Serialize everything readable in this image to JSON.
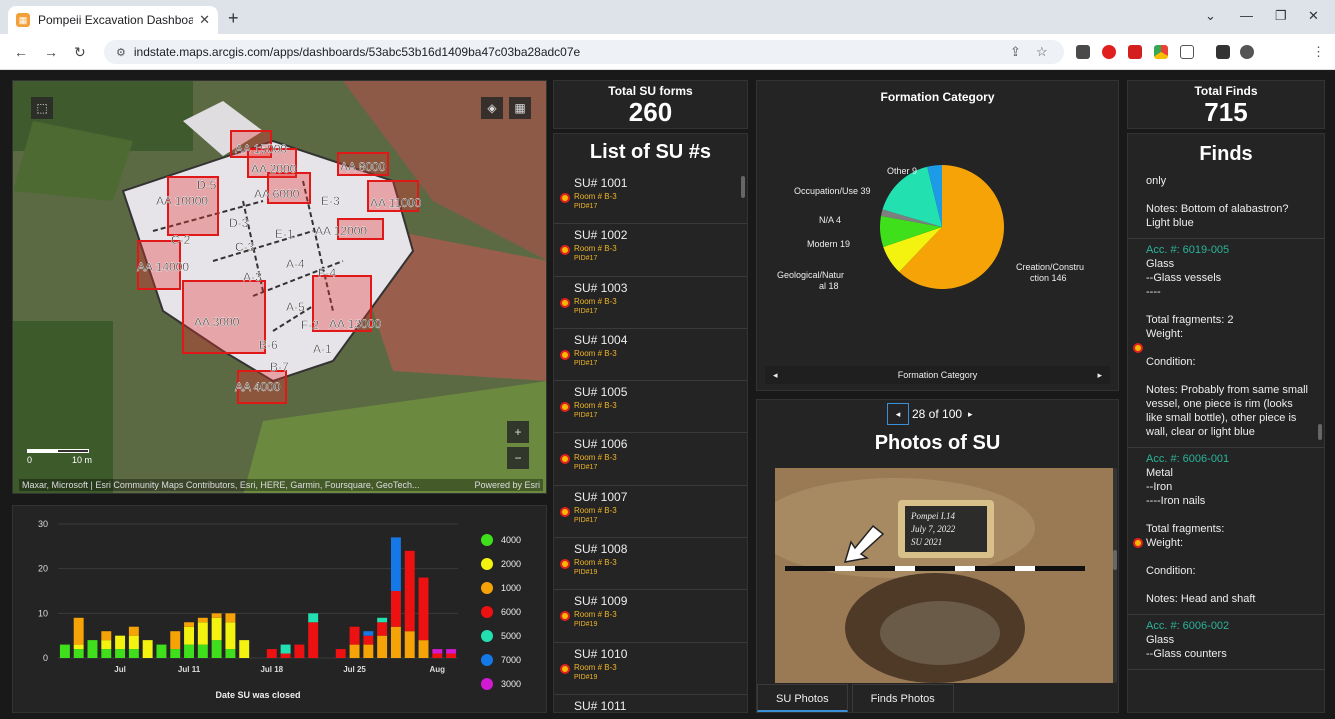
{
  "browser": {
    "tab_title": "Pompeii Excavation Dashboard",
    "url": "indstate.maps.arcgis.com/apps/dashboards/53abc53b16d1409ba47c03ba28adc07e"
  },
  "map": {
    "attribution": "Maxar, Microsoft | Esri Community Maps Contributors, Esri, HERE, Garmin, Foursquare, GeoTech...",
    "powered_by": "Powered by Esri",
    "scale_start": "0",
    "scale_end": "10 m",
    "zoom_in": "+",
    "zoom_out": "−",
    "area_labels": [
      "AA 15000",
      "AA 2000",
      "AA 8000",
      "D-5",
      "AA 6000",
      "E-3",
      "AA 11000",
      "AA 10000",
      "D-3",
      "E-1",
      "AA 12000",
      "C-2",
      "C-3",
      "A-4",
      "AA 14000",
      "A-3",
      "F-4",
      "AA 3000",
      "A-5",
      "F-2",
      "AA 13000",
      "B-6",
      "A-1",
      "B-7",
      "AA 4000"
    ]
  },
  "bar_chart": {
    "xlabel": "Date SU was closed",
    "legend": [
      {
        "name": "4000",
        "color": "#3fe01b"
      },
      {
        "name": "2000",
        "color": "#f3f30f"
      },
      {
        "name": "1000",
        "color": "#f5a306"
      },
      {
        "name": "6000",
        "color": "#ee1111"
      },
      {
        "name": "5000",
        "color": "#23e0b0"
      },
      {
        "name": "7000",
        "color": "#1479e6"
      },
      {
        "name": "3000",
        "color": "#d21ad2"
      }
    ]
  },
  "chart_data": [
    {
      "type": "bar",
      "stacked": true,
      "xlabel": "Date SU was closed",
      "ylim": [
        0,
        30
      ],
      "yticks": [
        0,
        10,
        20,
        30
      ],
      "x_tick_labels": [
        "Jul",
        "Jul 11",
        "Jul 18",
        "Jul 25",
        "Aug"
      ],
      "categories": [
        "b1",
        "b2",
        "b3",
        "b4",
        "b5",
        "b6",
        "b7",
        "b8",
        "b9",
        "b10",
        "b11",
        "b12",
        "b13",
        "b14",
        "b15",
        "b16",
        "b17",
        "b18",
        "b19",
        "b20",
        "b21",
        "b22",
        "b23",
        "b24",
        "b25",
        "b26",
        "b27",
        "b28",
        "b29"
      ],
      "series": [
        {
          "name": "4000",
          "values": [
            3,
            2,
            4,
            2,
            2,
            2,
            0,
            3,
            2,
            3,
            3,
            4,
            2,
            0,
            0,
            0,
            0,
            0,
            0,
            0,
            0,
            0,
            0,
            0,
            0,
            0,
            0,
            0,
            0
          ]
        },
        {
          "name": "2000",
          "values": [
            0,
            1,
            0,
            2,
            3,
            3,
            4,
            0,
            0,
            4,
            5,
            5,
            6,
            4,
            0,
            0,
            0,
            0,
            0,
            0,
            0,
            0,
            0,
            0,
            0,
            0,
            0,
            0,
            0
          ]
        },
        {
          "name": "1000",
          "values": [
            0,
            6,
            0,
            2,
            0,
            2,
            0,
            0,
            4,
            1,
            1,
            1,
            2,
            0,
            0,
            0,
            0,
            0,
            0,
            0,
            0,
            3,
            3,
            5,
            7,
            6,
            4,
            0,
            0
          ]
        },
        {
          "name": "6000",
          "values": [
            0,
            0,
            0,
            0,
            0,
            0,
            0,
            0,
            0,
            0,
            0,
            0,
            0,
            0,
            0,
            2,
            1,
            3,
            8,
            0,
            2,
            4,
            2,
            3,
            8,
            18,
            14,
            1,
            1
          ]
        },
        {
          "name": "5000",
          "values": [
            0,
            0,
            0,
            0,
            0,
            0,
            0,
            0,
            0,
            0,
            0,
            0,
            0,
            0,
            0,
            0,
            2,
            0,
            2,
            0,
            0,
            0,
            0,
            1,
            0,
            0,
            0,
            0,
            0
          ]
        },
        {
          "name": "7000",
          "values": [
            0,
            0,
            0,
            0,
            0,
            0,
            0,
            0,
            0,
            0,
            0,
            0,
            0,
            0,
            0,
            0,
            0,
            0,
            0,
            0,
            0,
            0,
            1,
            0,
            12,
            0,
            0,
            0,
            0
          ]
        },
        {
          "name": "3000",
          "values": [
            0,
            0,
            0,
            0,
            0,
            0,
            0,
            0,
            0,
            0,
            0,
            0,
            0,
            0,
            0,
            0,
            0,
            0,
            0,
            0,
            0,
            0,
            0,
            0,
            0,
            0,
            0,
            1,
            1
          ]
        }
      ]
    },
    {
      "type": "pie",
      "title": "Formation Category",
      "slices": [
        {
          "label": "Creation/Construction 146",
          "value": 146,
          "color": "#f5a306"
        },
        {
          "label": "Geological/Natural 18",
          "value": 18,
          "color": "#f3f30f"
        },
        {
          "label": "Modern 19",
          "value": 19,
          "color": "#3fe01b"
        },
        {
          "label": "N/A 4",
          "value": 4,
          "color": "#7f7f7f"
        },
        {
          "label": "Occupation/Use 39",
          "value": 39,
          "color": "#23e0b0"
        },
        {
          "label": "Other 9",
          "value": 9,
          "color": "#1e9be6"
        }
      ]
    }
  ],
  "total_su": {
    "label": "Total SU forms",
    "value": "260"
  },
  "su_list": {
    "title": "List of SU #s",
    "items": [
      {
        "su": "SU# 1001",
        "room": "Room # B-3",
        "pid": "PID#17"
      },
      {
        "su": "SU# 1002",
        "room": "Room # B-3",
        "pid": "PID#17"
      },
      {
        "su": "SU# 1003",
        "room": "Room # B-3",
        "pid": "PID#17"
      },
      {
        "su": "SU# 1004",
        "room": "Room # B-3",
        "pid": "PID#17"
      },
      {
        "su": "SU# 1005",
        "room": "Room # B-3",
        "pid": "PID#17"
      },
      {
        "su": "SU# 1006",
        "room": "Room # B-3",
        "pid": "PID#17"
      },
      {
        "su": "SU# 1007",
        "room": "Room # B-3",
        "pid": "PID#17"
      },
      {
        "su": "SU# 1008",
        "room": "Room # B-3",
        "pid": "PID#19"
      },
      {
        "su": "SU# 1009",
        "room": "Room # B-3",
        "pid": "PID#19"
      },
      {
        "su": "SU# 1010",
        "room": "Room # B-3",
        "pid": "PID#19"
      },
      {
        "su": "SU# 1011",
        "room": "",
        "pid": ""
      }
    ]
  },
  "pie": {
    "title": "Formation Category",
    "nav_label": "Formation Category",
    "labels": {
      "other": "Other 9",
      "occupation": "Occupation/Use 39",
      "na": "N/A 4",
      "modern": "Modern 19",
      "geological_1": "Geological/Natur",
      "geological_2": "al 18",
      "creation_1": "Creation/Constru",
      "creation_2": "ction 146"
    }
  },
  "photos": {
    "pager": "28 of 100",
    "title": "Photos of SU",
    "tabs": [
      "SU Photos",
      "Finds Photos"
    ],
    "slate_text": [
      "Pompei I.14",
      "July 7, 2022",
      "SU 2021"
    ]
  },
  "total_finds": {
    "label": "Total Finds",
    "value": "715"
  },
  "finds": {
    "title": "Finds",
    "items": [
      {
        "lines": [
          "only",
          "",
          "Notes: Bottom of alabastron? Light blue"
        ]
      },
      {
        "acc": "Acc. #: 6019-005",
        "lines": [
          "Glass",
          "--Glass vessels",
          "----",
          "",
          "Total fragments: 2",
          "Weight:",
          "",
          "Condition:",
          "",
          "Notes: Probably from same small vessel, one piece is rim (looks like small bottle), other piece is wall, clear or light blue"
        ]
      },
      {
        "acc": "Acc. #: 6006-001",
        "lines": [
          "Metal",
          "--Iron",
          "----Iron nails",
          "",
          "Total fragments:",
          "Weight:",
          "",
          "Condition:",
          "",
          "Notes: Head and shaft"
        ]
      },
      {
        "acc": "Acc. #: 6006-002",
        "lines": [
          "Glass",
          "--Glass counters"
        ]
      }
    ]
  }
}
